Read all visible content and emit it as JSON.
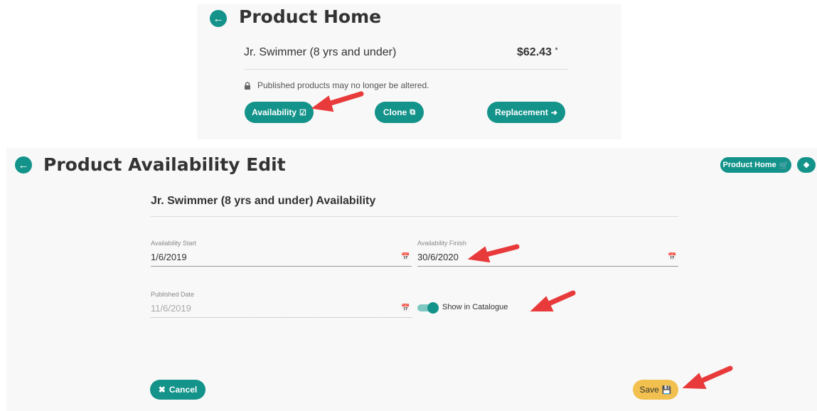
{
  "product_home": {
    "title": "Product Home",
    "product_name": "Jr. Swimmer (8 yrs and under)",
    "price": "$62.43",
    "price_marker": "*",
    "notice": "Published products may no longer be altered.",
    "buttons": {
      "availability": "Availability",
      "clone": "Clone",
      "replacement": "Replacement"
    }
  },
  "availability_edit": {
    "title": "Product Availability Edit",
    "header_buttons": {
      "product_home": "Product Home"
    },
    "section_title": "Jr. Swimmer (8 yrs and under) Availability",
    "fields": {
      "start": {
        "label": "Availability Start",
        "value": "1/6/2019"
      },
      "finish": {
        "label": "Availability Finish",
        "value": "30/6/2020"
      },
      "published": {
        "label": "Published Date",
        "value": "11/6/2019"
      }
    },
    "toggle": {
      "label": "Show in Catalogue",
      "on": true
    },
    "cancel_label": "Cancel",
    "save_label": "Save"
  },
  "icons": {
    "back": "arrow-left-circle-icon",
    "lock": "lock-icon",
    "calendar": "calendar-icon",
    "clone": "copy-icon",
    "replacement": "sign-in-icon",
    "cart": "cart-icon",
    "tag": "tag-icon",
    "times": "times-icon",
    "save": "floppy-disk-icon"
  },
  "colors": {
    "primary": "#13938a",
    "save": "#f2c04e",
    "annotation_arrow": "#e83a3a",
    "panel_bg": "#f8f8f8"
  }
}
